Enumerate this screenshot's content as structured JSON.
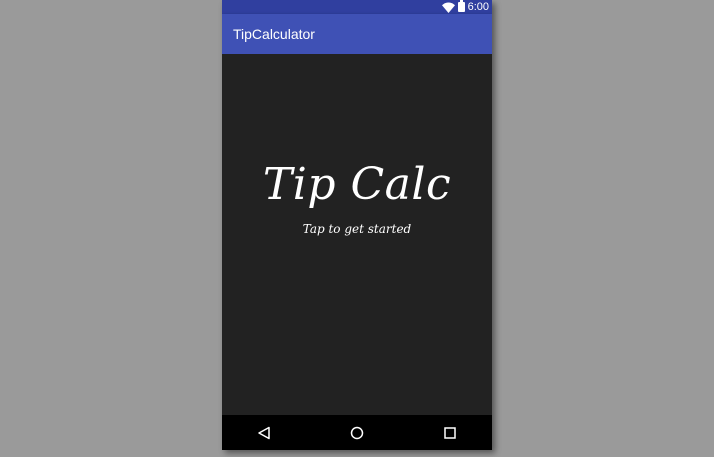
{
  "status_bar": {
    "time": "6:00",
    "icons": [
      "wifi-icon",
      "battery-icon"
    ]
  },
  "app_bar": {
    "title": "TipCalculator"
  },
  "splash": {
    "title": "Tip Calc",
    "subtitle": "Tap to get started"
  },
  "nav_bar": {
    "buttons": [
      "back-icon",
      "home-icon",
      "recents-icon"
    ]
  },
  "colors": {
    "status_bar": "#303F9F",
    "app_bar": "#3F51B5",
    "background": "#222222",
    "nav_bar": "#000000",
    "desktop": "#9A9A9A"
  }
}
